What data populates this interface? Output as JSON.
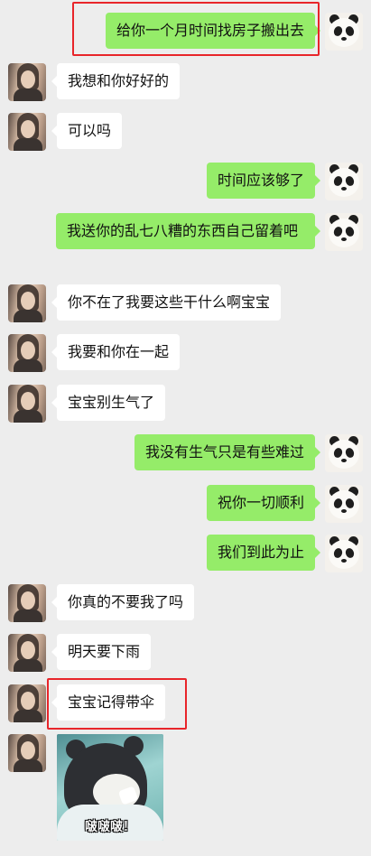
{
  "messages": [
    {
      "side": "right",
      "text": "给你一个月时间找房子搬出去"
    },
    {
      "side": "left",
      "text": "我想和你好好的"
    },
    {
      "side": "left",
      "text": "可以吗"
    },
    {
      "side": "right",
      "text": "时间应该够了"
    },
    {
      "side": "right",
      "text": "我送你的乱七八糟的东西自己留着吧"
    },
    {
      "side": "left",
      "text": "你不在了我要这些干什么啊宝宝"
    },
    {
      "side": "left",
      "text": "我要和你在一起"
    },
    {
      "side": "left",
      "text": "宝宝别生气了"
    },
    {
      "side": "right",
      "text": "我没有生气只是有些难过"
    },
    {
      "side": "right",
      "text": "祝你一切顺利"
    },
    {
      "side": "right",
      "text": "我们到此为止"
    },
    {
      "side": "left",
      "text": "你真的不要我了吗"
    },
    {
      "side": "left",
      "text": "明天要下雨"
    },
    {
      "side": "left",
      "text": "宝宝记得带伞"
    }
  ],
  "sticker": {
    "caption": "啵啵啵！"
  },
  "colors": {
    "sent_bubble": "#95ec69",
    "received_bubble": "#ffffff",
    "background": "#ededed",
    "highlight": "#e8252a"
  },
  "avatars": {
    "sent": "panda-avatar",
    "received": "girl-photo-avatar"
  }
}
